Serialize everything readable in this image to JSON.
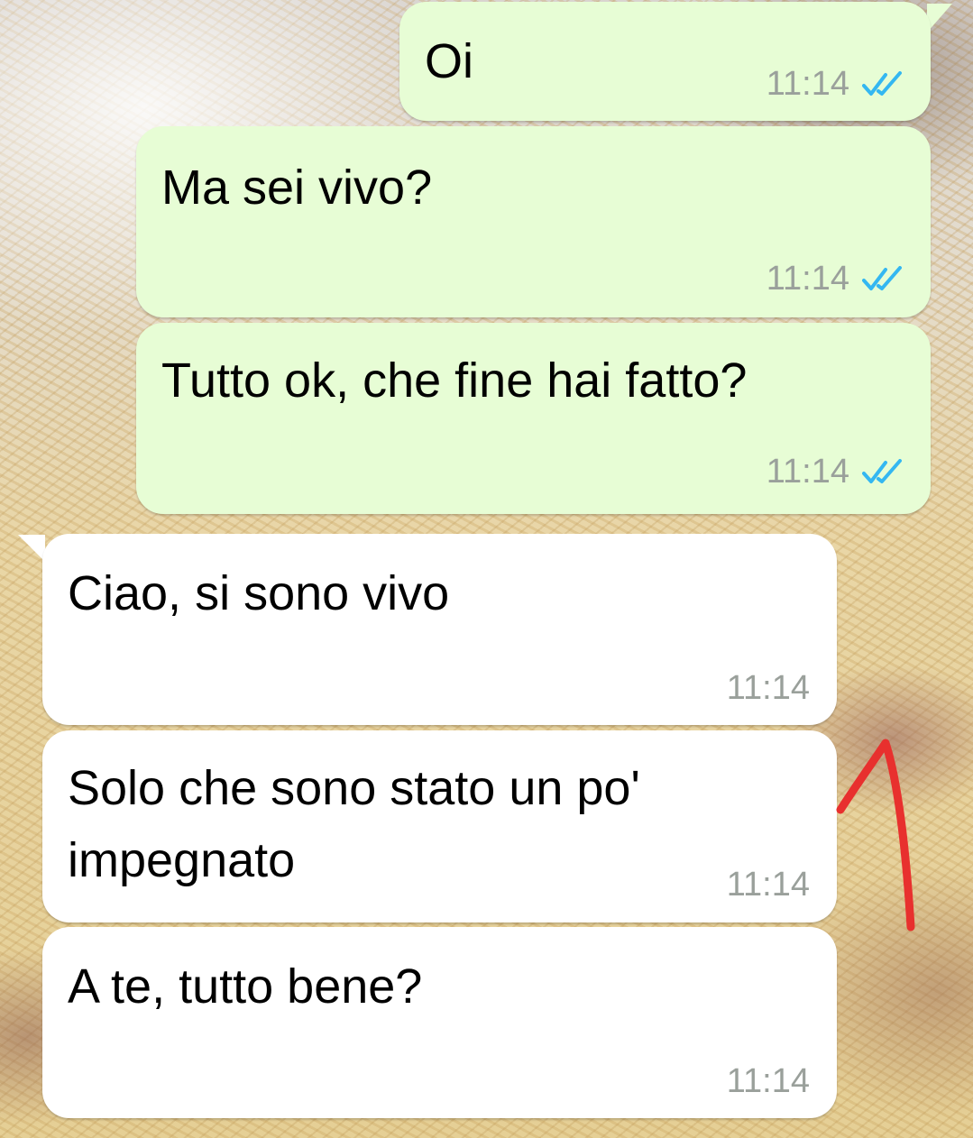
{
  "colors": {
    "outgoing_bubble": "#e7fdd5",
    "incoming_bubble": "#ffffff",
    "read_ticks": "#34b7f1",
    "timestamp": "#9aa09b",
    "annotation_arrow": "#e8302e"
  },
  "messages": [
    {
      "direction": "outgoing",
      "text": "Oi",
      "time": "11:14",
      "status_icon": "double-check-read-icon"
    },
    {
      "direction": "outgoing",
      "text": "Ma sei vivo?",
      "time": "11:14",
      "status_icon": "double-check-read-icon"
    },
    {
      "direction": "outgoing",
      "text": "Tutto ok, che fine hai fatto?",
      "time": "11:14",
      "status_icon": "double-check-read-icon"
    },
    {
      "direction": "incoming",
      "text": "Ciao, si sono vivo",
      "time": "11:14"
    },
    {
      "direction": "incoming",
      "text": "Solo che sono stato un po'\nimpegnato",
      "time": "11:14"
    },
    {
      "direction": "incoming",
      "text": "A te, tutto bene?",
      "time": "11:14"
    }
  ],
  "annotation": {
    "icon": "red-arrow-icon",
    "points_to": "message 5"
  }
}
